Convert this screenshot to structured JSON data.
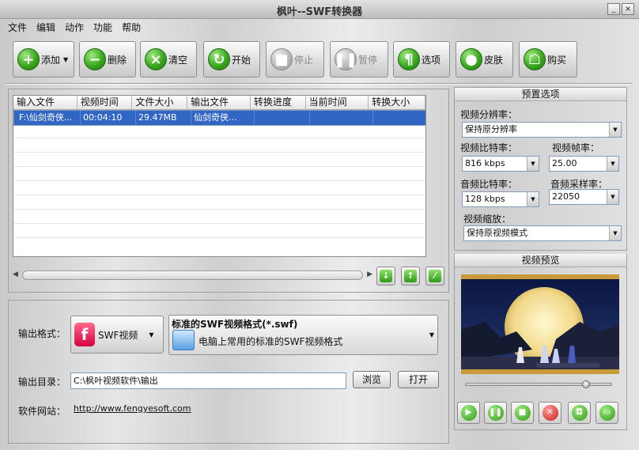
{
  "window": {
    "title": "枫叶--SWF转换器",
    "minimize": "_",
    "close": "×"
  },
  "menu": [
    "文件",
    "编辑",
    "动作",
    "功能",
    "帮助"
  ],
  "toolbar": {
    "add": "添加",
    "delete": "删除",
    "clear": "清空",
    "start": "开始",
    "stop": "停止",
    "pause": "暂停",
    "options": "选项",
    "skin": "皮肤",
    "buy": "购买"
  },
  "file_table": {
    "columns": [
      "输入文件",
      "视频时间",
      "文件大小",
      "输出文件",
      "转换进度",
      "当前时间",
      "转换大小"
    ],
    "rows": [
      [
        "F:\\仙剑奇侠...",
        "00:04:10",
        "29.47MB",
        "仙剑奇侠...",
        "",
        "",
        ""
      ]
    ]
  },
  "output": {
    "format_label": "输出格式：",
    "format_button": "SWF视频",
    "format_title": "标准的SWF视频格式(*.swf)",
    "format_desc": "电脑上常用的标准的SWF视频格式",
    "dir_label": "输出目录：",
    "dir_value": "C:\\枫叶视频软件\\输出",
    "browse": "浏览",
    "open": "打开",
    "site_label": "软件网站：",
    "site_url": "http://www.fengyesoft.com"
  },
  "presets": {
    "header": "预置选项",
    "resolution_label": "视频分辨率：",
    "resolution_value": "保持原分辨率",
    "vbitrate_label": "视频比特率：",
    "vbitrate_value": "816 kbps",
    "framerate_label": "视频帧率：",
    "framerate_value": "25.00",
    "abitrate_label": "音频比特率：",
    "abitrate_value": "128 kbps",
    "samplerate_label": "音频采样率：",
    "samplerate_value": "22050",
    "zoom_label": "视频缩放：",
    "zoom_value": "保持原视频模式"
  },
  "preview": {
    "header": "视频预览",
    "seek_fraction": 0.82
  }
}
